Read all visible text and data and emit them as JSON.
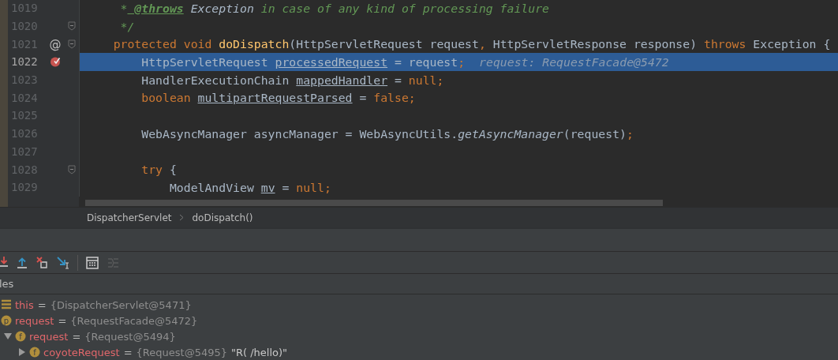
{
  "editor": {
    "lines": [
      {
        "number": "1019",
        "current": false,
        "fold": false,
        "segments": [
          {
            "t": "     *",
            "kind": "cm"
          },
          {
            "t": " @throws",
            "kind": "tag"
          },
          {
            "t": " Exception",
            "kind": "it"
          },
          {
            "t": " in case of any kind of processing failure",
            "kind": "cm"
          }
        ]
      },
      {
        "number": "1020",
        "current": false,
        "fold": true,
        "segments": [
          {
            "t": "     */",
            "kind": "cm"
          }
        ]
      },
      {
        "number": "1021",
        "current": false,
        "fold": true,
        "gutter": {
          "kind": "text",
          "text": "@"
        },
        "segments": [
          {
            "t": "    protected void ",
            "kind": "kw"
          },
          {
            "t": "doDispatch",
            "kind": "fn"
          },
          {
            "t": "(HttpServletRequest request",
            "kind": "plain"
          },
          {
            "t": ",",
            "kind": "op"
          },
          {
            "t": " HttpServletResponse response) ",
            "kind": "plain"
          },
          {
            "t": "throws",
            "kind": "kw"
          },
          {
            "t": " Exception {",
            "kind": "plain"
          }
        ]
      },
      {
        "number": "1022",
        "current": true,
        "fold": false,
        "gutter": {
          "kind": "breakpoint"
        },
        "segments": [
          {
            "t": "        HttpServletRequest ",
            "kind": "plain"
          },
          {
            "t": "processedRequest",
            "kind": "ul"
          },
          {
            "t": " = request",
            "kind": "plain"
          },
          {
            "t": ";",
            "kind": "op"
          }
        ],
        "hint": "request: RequestFacade@5472"
      },
      {
        "number": "1023",
        "current": false,
        "fold": false,
        "segments": [
          {
            "t": "        HandlerExecutionChain ",
            "kind": "plain"
          },
          {
            "t": "mappedHandler",
            "kind": "ul"
          },
          {
            "t": " = ",
            "kind": "plain"
          },
          {
            "t": "null;",
            "kind": "kw"
          }
        ]
      },
      {
        "number": "1024",
        "current": false,
        "fold": false,
        "segments": [
          {
            "t": "        boolean ",
            "kind": "kw"
          },
          {
            "t": "multipartRequestParsed",
            "kind": "ul"
          },
          {
            "t": " = ",
            "kind": "plain"
          },
          {
            "t": "false;",
            "kind": "kw"
          }
        ]
      },
      {
        "number": "1025",
        "current": false,
        "fold": false
      },
      {
        "number": "1026",
        "current": false,
        "fold": false,
        "segments": [
          {
            "t": "        WebAsyncManager asyncManager = WebAsyncUtils.",
            "kind": "plain"
          },
          {
            "t": "getAsyncManager",
            "kind": "it"
          },
          {
            "t": "(request)",
            "kind": "plain"
          },
          {
            "t": ";",
            "kind": "op"
          }
        ]
      },
      {
        "number": "1027",
        "current": false,
        "fold": false
      },
      {
        "number": "1028",
        "current": false,
        "fold": true,
        "segments": [
          {
            "t": "        try",
            "kind": "kw"
          },
          {
            "t": " {",
            "kind": "plain"
          }
        ]
      },
      {
        "number": "1029",
        "current": false,
        "fold": false,
        "segments": [
          {
            "t": "            ModelAndView ",
            "kind": "plain"
          },
          {
            "t": "mv",
            "kind": "ul"
          },
          {
            "t": " = ",
            "kind": "plain"
          },
          {
            "t": "null;",
            "kind": "kw"
          }
        ]
      }
    ]
  },
  "breadcrumbs": [
    "DispatcherServlet",
    "doDispatch()"
  ],
  "toolbar": [
    {
      "kind": "step-down",
      "disabled": false
    },
    {
      "kind": "step-out",
      "disabled": false
    },
    {
      "kind": "drop-frame",
      "disabled": false
    },
    {
      "kind": "run-to-cursor",
      "disabled": false
    },
    {
      "kind": "separator"
    },
    {
      "kind": "evaluate",
      "disabled": false
    },
    {
      "kind": "trace",
      "disabled": true
    }
  ],
  "variables": {
    "header": "les",
    "items": [
      {
        "kind": "stack",
        "name": "this",
        "sign": "=",
        "value": "{DispatcherServlet@5471}"
      },
      {
        "kind": "p",
        "name": "request",
        "sign": "=",
        "value": "{RequestFacade@5472}",
        "children": [
          {
            "kind": "f",
            "name": "request",
            "sign": "=",
            "value": "{Request@5494}",
            "expanded": true,
            "children": [
              {
                "kind": "f",
                "name": "coyoteRequest",
                "sign": "=",
                "value": "{Request@5495}",
                "extra": "\"R( /hello)\"",
                "expanded": false
              }
            ]
          }
        ]
      }
    ]
  }
}
